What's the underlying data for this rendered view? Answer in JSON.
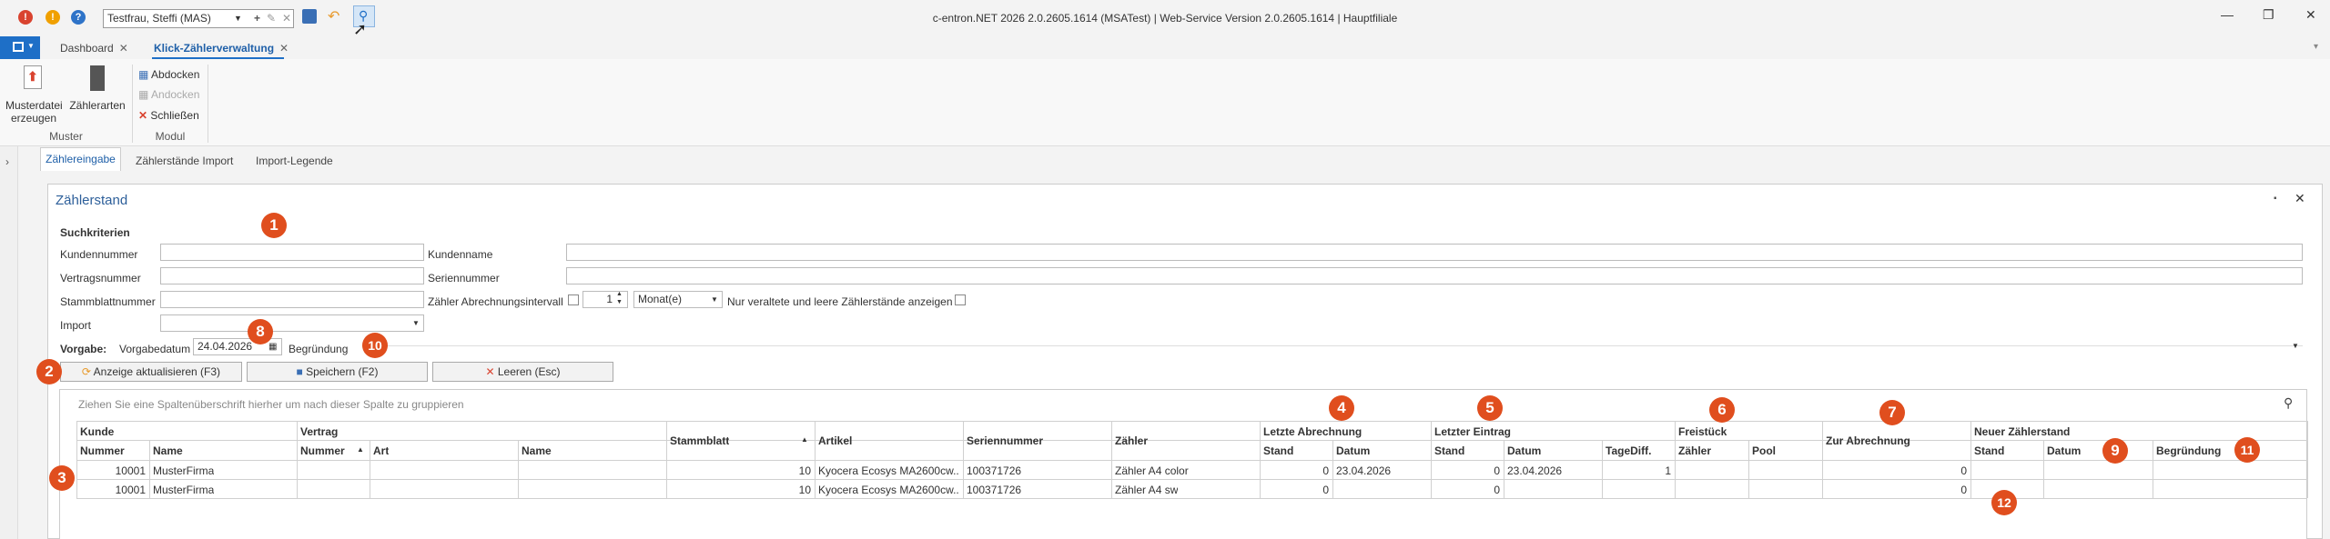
{
  "window": {
    "title": "c-entron.NET 2026 2.0.2605.1614 (MSATest) | Web-Service Version 2.0.2605.1614 | Hauptfiliale",
    "user_select": "Testfrau, Steffi (MAS)"
  },
  "doc_tabs": [
    {
      "label": "Dashboard",
      "close": "✕"
    },
    {
      "label": "Klick-Zählerverwaltung",
      "close": "✕"
    }
  ],
  "ribbon": {
    "muster_group": "Muster",
    "modul_group": "Modul",
    "musterdatei_line1": "Musterdatei",
    "musterdatei_line2": "erzeugen",
    "zaehlerarten": "Zählerarten",
    "abdocken": "Abdocken",
    "andocken": "Andocken",
    "schliessen": "Schließen"
  },
  "sub_tabs": [
    "Zählereingabe",
    "Zählerstände Import",
    "Import-Legende"
  ],
  "panel": {
    "title": "Zählerstand",
    "suchkriterien": "Suchkriterien",
    "kundennummer": "Kundennummer",
    "kundenname": "Kundenname",
    "vertragsnummer": "Vertragsnummer",
    "seriennummer": "Seriennummer",
    "stammblattnummer": "Stammblattnummer",
    "intervall_label": "Zähler Abrechnungsintervall",
    "intervall_value": "1",
    "intervall_unit": "Monat(e)",
    "nur_veraltete": "Nur veraltete und leere Zählerstände anzeigen",
    "import": "Import",
    "vorgabe": "Vorgabe:",
    "vorgabedatum": "Vorgabedatum",
    "vorgabedatum_value": "24.04.2026",
    "begruendung": "Begründung",
    "btn_refresh": "Anzeige aktualisieren (F3)",
    "btn_save": "Speichern (F2)",
    "btn_clear": "Leeren (Esc)"
  },
  "badges": [
    "1",
    "2",
    "3",
    "4",
    "5",
    "6",
    "7",
    "8",
    "9",
    "10",
    "11",
    "12"
  ],
  "grid": {
    "group_hint": "Ziehen Sie eine Spaltenüberschrift hierher um nach dieser Spalte zu gruppieren",
    "groups": {
      "kunde": "Kunde",
      "vertrag": "Vertrag",
      "letzte_abrechnung": "Letzte Abrechnung",
      "letzter_eintrag": "Letzter Eintrag",
      "freistueck": "Freistück",
      "neuer_zaehlerstand": "Neuer Zählerstand"
    },
    "columns": {
      "nummer": "Nummer",
      "name": "Name",
      "v_nummer": "Nummer",
      "art": "Art",
      "v_name": "Name",
      "stammblatt": "Stammblatt",
      "artikel": "Artikel",
      "seriennummer": "Seriennummer",
      "zaehler": "Zähler",
      "la_stand": "Stand",
      "la_datum": "Datum",
      "le_stand": "Stand",
      "le_datum": "Datum",
      "tagediff": "TageDiff.",
      "fs_zaehler": "Zähler",
      "fs_pool": "Pool",
      "zur_abrechnung": "Zur Abrechnung",
      "nz_stand": "Stand",
      "nz_datum": "Datum",
      "nz_begruendung": "Begründung"
    },
    "rows": [
      {
        "nummer": "10001",
        "name": "MusterFirma",
        "stammblatt": "10",
        "artikel": "Kyocera Ecosys MA2600cw...",
        "seriennummer": "100371726",
        "zaehler": "Zähler A4 color",
        "la_stand": "0",
        "la_datum": "23.04.2026",
        "le_stand": "0",
        "le_datum": "23.04.2026",
        "tagediff": "1",
        "zur_abrechnung": "0"
      },
      {
        "nummer": "10001",
        "name": "MusterFirma",
        "stammblatt": "10",
        "artikel": "Kyocera Ecosys MA2600cw...",
        "seriennummer": "100371726",
        "zaehler": "Zähler A4 sw",
        "la_stand": "0",
        "la_datum": "",
        "le_stand": "0",
        "le_datum": "",
        "tagediff": "",
        "zur_abrechnung": "0"
      }
    ]
  },
  "colors": {
    "accent": "#1e6fc7",
    "badge": "#e04e1e",
    "title_blue": "#2d5f9a"
  }
}
